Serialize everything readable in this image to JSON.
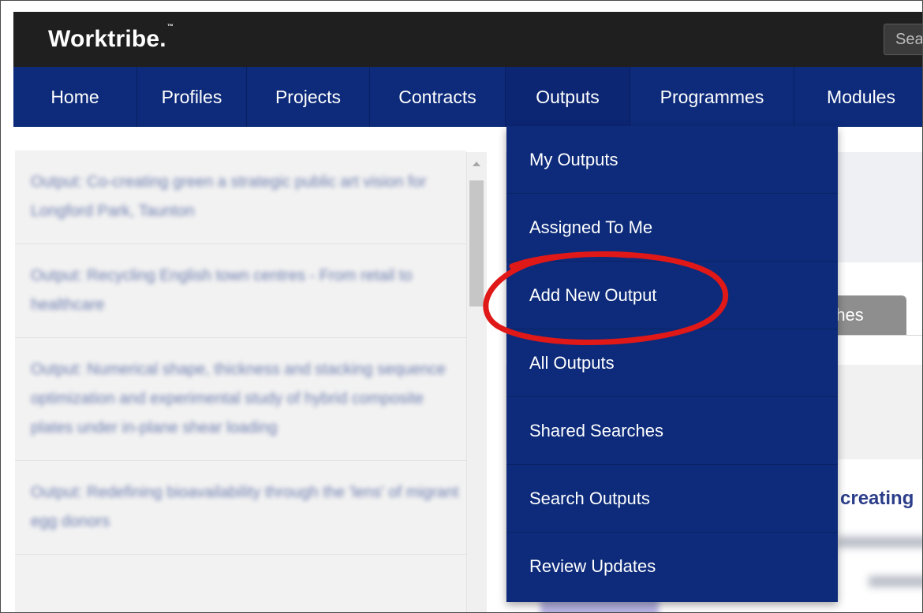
{
  "brand": {
    "name": "Worktribe.",
    "tm": "™"
  },
  "search": {
    "placeholder": "Sea"
  },
  "nav": {
    "items": [
      {
        "label": "Home"
      },
      {
        "label": "Profiles"
      },
      {
        "label": "Projects"
      },
      {
        "label": "Contracts"
      },
      {
        "label": "Outputs"
      },
      {
        "label": "Programmes"
      },
      {
        "label": "Modules"
      }
    ]
  },
  "dropdown": {
    "items": [
      {
        "label": "My Outputs"
      },
      {
        "label": "Assigned To Me"
      },
      {
        "label": "Add New Output"
      },
      {
        "label": "All Outputs"
      },
      {
        "label": "Shared Searches"
      },
      {
        "label": "Search Outputs"
      },
      {
        "label": "Review Updates"
      }
    ]
  },
  "left_list": {
    "items": [
      {
        "text": "Output: Co-creating green a strategic public art vision for Longford Park, Taunton"
      },
      {
        "text": "Output: Recycling English town centres - From retail to healthcare"
      },
      {
        "text": "Output: Numerical shape, thickness and stacking sequence optimization and experimental study of hybrid composite plates under in-plane shear loading"
      },
      {
        "text": "Output: Redefining bioavailability through the 'lens' of migrant egg donors"
      }
    ]
  },
  "right": {
    "tab_label": "rches",
    "card_title": "creating"
  },
  "colors": {
    "nav_bg": "#0d2b7a",
    "brand_bar": "#1f1f1f",
    "annotation": "#e01818"
  },
  "annotation": {
    "icon": "hand-drawn-red-circle",
    "target": "Add New Output"
  }
}
